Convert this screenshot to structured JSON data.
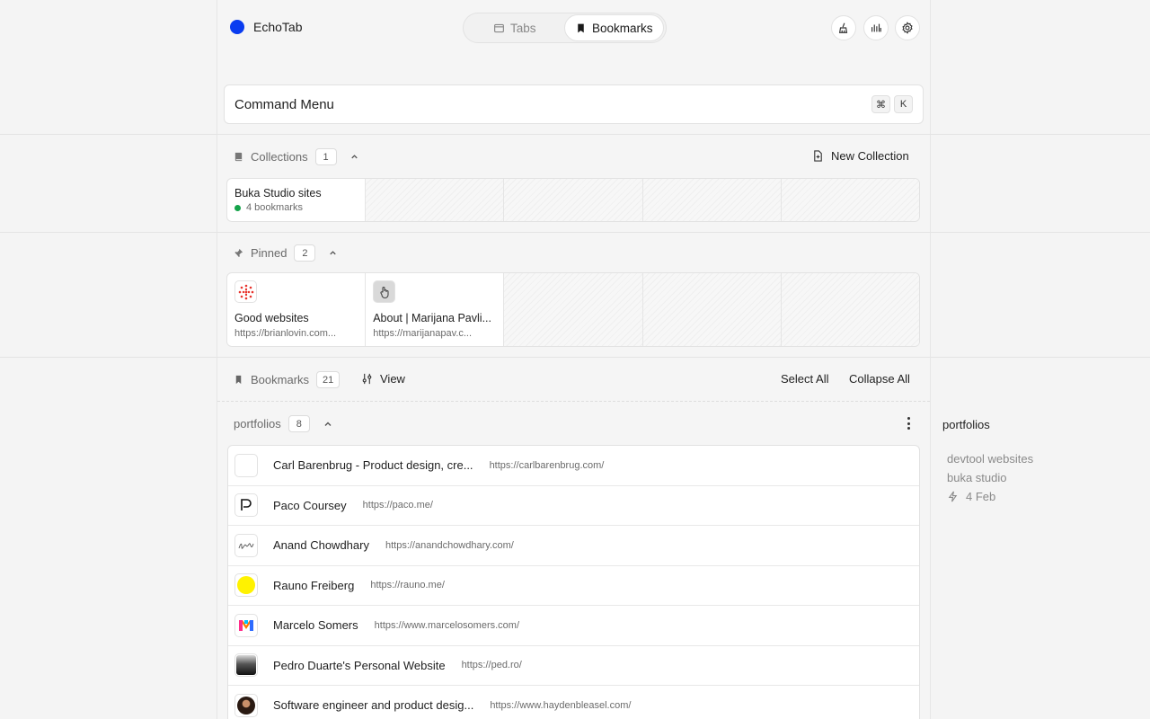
{
  "app": {
    "name": "EchoTab"
  },
  "toggle": {
    "tabs_label": "Tabs",
    "bookmarks_label": "Bookmarks"
  },
  "command_menu": {
    "label": "Command Menu",
    "shortcut_mod": "⌘",
    "shortcut_key": "K"
  },
  "collections": {
    "label": "Collections",
    "count": "1",
    "new_label": "New Collection",
    "items": [
      {
        "title": "Buka Studio sites",
        "subtitle": "4 bookmarks"
      }
    ]
  },
  "pinned": {
    "label": "Pinned",
    "count": "2",
    "items": [
      {
        "title": "Good websites",
        "url": "https://brianlovin.com..."
      },
      {
        "title": "About | Marijana Pavli...",
        "url": "https://marijanapav.c..."
      }
    ]
  },
  "bookmarks": {
    "label": "Bookmarks",
    "count": "21",
    "view_label": "View",
    "select_all": "Select All",
    "collapse_all": "Collapse All"
  },
  "group": {
    "name": "portfolios",
    "count": "8",
    "rows": [
      {
        "title": "Carl Barenbrug - Product design, cre...",
        "url": "https://carlbarenbrug.com/"
      },
      {
        "title": "Paco Coursey",
        "url": "https://paco.me/"
      },
      {
        "title": "Anand Chowdhary",
        "url": "https://anandchowdhary.com/"
      },
      {
        "title": "Rauno Freiberg",
        "url": "https://rauno.me/"
      },
      {
        "title": "Marcelo Somers",
        "url": "https://www.marcelosomers.com/"
      },
      {
        "title": "Pedro Duarte's Personal Website",
        "url": "https://ped.ro/"
      },
      {
        "title": "Software engineer and product desig...",
        "url": "https://www.haydenbleasel.com/"
      }
    ]
  },
  "side_panel": {
    "title": "portfolios",
    "items": [
      "devtool websites",
      "buka studio"
    ],
    "date": "4 Feb"
  },
  "colors": {
    "brand": "#0a3cf0",
    "status_green": "#15a34a",
    "rauno_yellow": "#fff200"
  }
}
